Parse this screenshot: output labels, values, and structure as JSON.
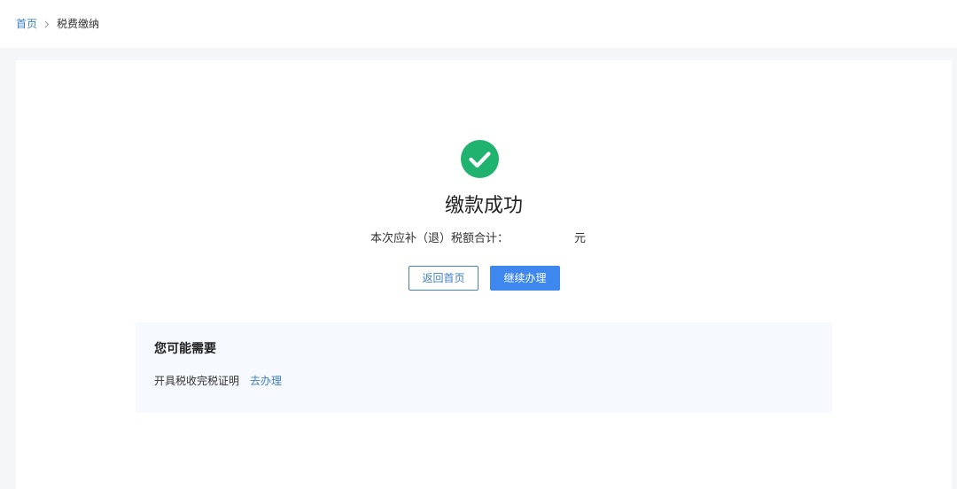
{
  "breadcrumb": {
    "home": "首页",
    "current": "税费缴纳"
  },
  "result": {
    "icon": "check-circle-icon",
    "icon_color": "#1fb36f",
    "title": "缴款成功",
    "amount_label": "本次应补（退）税额合计：",
    "amount_value": "",
    "amount_unit": "元"
  },
  "actions": {
    "back_label": "返回首页",
    "continue_label": "继续办理",
    "primary_color": "#3e87ee"
  },
  "recommend": {
    "title": "您可能需要",
    "items": [
      {
        "label": "开具税收完税证明",
        "link": "去办理"
      }
    ]
  }
}
